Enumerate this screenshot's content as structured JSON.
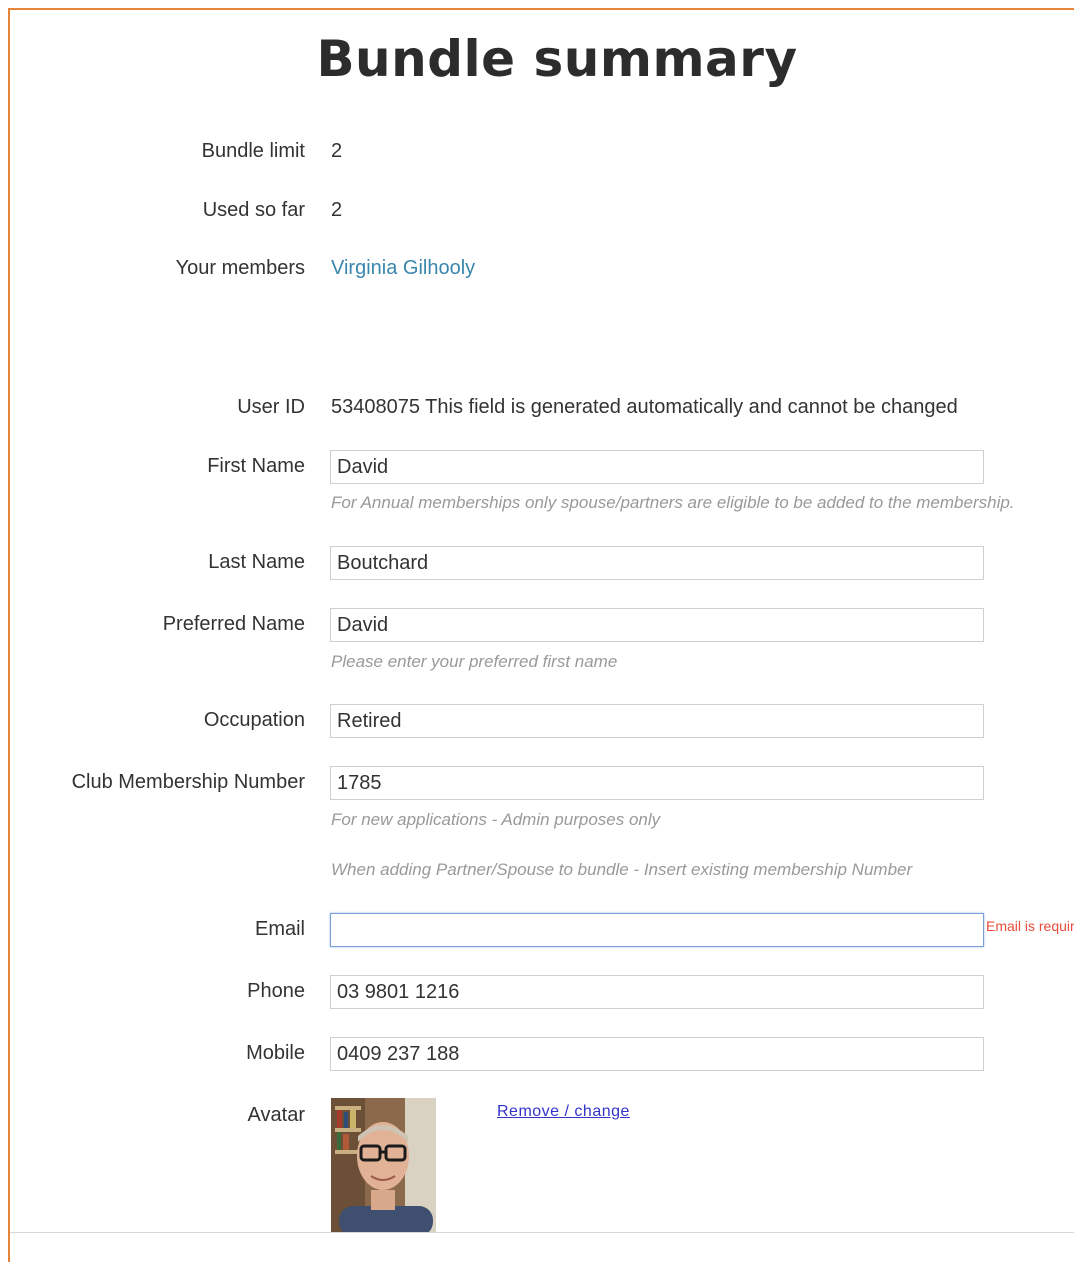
{
  "title": "Bundle summary",
  "summary": {
    "bundle_limit_label": "Bundle limit",
    "bundle_limit_value": "2",
    "used_so_far_label": "Used so far",
    "used_so_far_value": "2",
    "your_members_label": "Your members",
    "your_members_value": "Virginia Gilhooly"
  },
  "form": {
    "user_id_label": "User ID",
    "user_id_value": "53408075 This field is generated automatically and cannot be changed",
    "first_name_label": "First Name",
    "first_name_value": "David",
    "first_name_help": "For Annual memberships only spouse/partners are eligible to be added to the membership.",
    "last_name_label": "Last Name",
    "last_name_value": "Boutchard",
    "preferred_name_label": "Preferred Name",
    "preferred_name_value": "David",
    "preferred_name_help": "Please enter your preferred first name",
    "occupation_label": "Occupation",
    "occupation_value": "Retired",
    "club_number_label": "Club Membership Number",
    "club_number_value": "1785",
    "club_number_help_1": "For new applications - Admin purposes only",
    "club_number_help_2": "When adding Partner/Spouse to bundle - Insert existing membership Number",
    "email_label": "Email",
    "email_value": "",
    "email_error": "Email is required",
    "phone_label": "Phone",
    "phone_value": "03 9801 1216",
    "mobile_label": "Mobile",
    "mobile_value": "0409 237 188",
    "avatar_label": "Avatar",
    "avatar_link": "Remove / change"
  },
  "colors": {
    "frame": "#e8833a",
    "link": "#3a87ad",
    "error": "#e74c3c"
  }
}
